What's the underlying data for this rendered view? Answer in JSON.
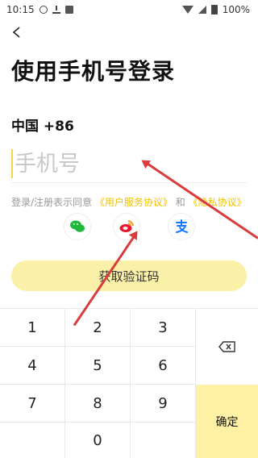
{
  "status_bar": {
    "time": "10:15",
    "battery": "100%"
  },
  "login": {
    "title": "使用手机号登录",
    "country_code": "中国 +86",
    "phone_placeholder": "手机号",
    "agreement_prefix": "登录/注册表示同意",
    "user_agreement": "《用户服务协议》",
    "and": "和",
    "privacy_agreement": "《隐私协议》",
    "get_code": "获取验证码"
  },
  "social_logins": [
    "wechat-icon",
    "weibo-icon",
    "alipay-icon"
  ],
  "keyboard": {
    "keys": [
      "1",
      "2",
      "3",
      "4",
      "5",
      "6",
      "7",
      "8",
      "9",
      "0"
    ],
    "confirm": "确定"
  },
  "colors": {
    "accent": "#f2d742",
    "button_bg": "#fbf0a8",
    "keypad_confirm_bg": "#fff1a4",
    "annotation_arrow": "#d83c3c"
  }
}
